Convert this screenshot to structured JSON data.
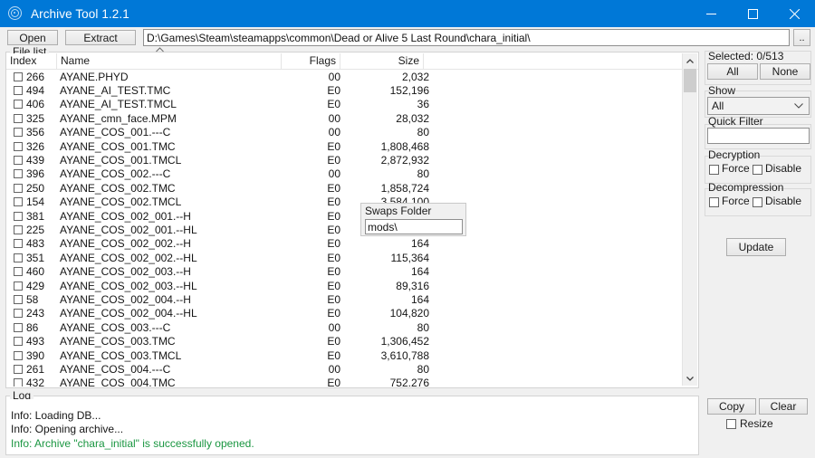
{
  "window": {
    "title": "Archive Tool 1.2.1",
    "icon": "archive-spiral-icon",
    "accent_color": "#0078d7",
    "minimize_label": "Minimize",
    "maximize_label": "Maximize",
    "close_label": "Close"
  },
  "toolbar": {
    "open_label": "Open",
    "extract_label": "Extract",
    "path_value": "D:\\Games\\Steam\\steamapps\\common\\Dead or Alive 5 Last Round\\chara_initial\\",
    "browse_label": ".."
  },
  "file_list": {
    "group_label": "File list",
    "sort_column": "Name",
    "sort_direction": "ascending",
    "columns": [
      "Index",
      "Name",
      "Flags",
      "Size"
    ],
    "rows": [
      {
        "index": "266",
        "name": "AYANE.PHYD",
        "flags": "00",
        "size": "2,032",
        "checked": false
      },
      {
        "index": "494",
        "name": "AYANE_AI_TEST.TMC",
        "flags": "E0",
        "size": "152,196",
        "checked": false
      },
      {
        "index": "406",
        "name": "AYANE_AI_TEST.TMCL",
        "flags": "E0",
        "size": "36",
        "checked": false
      },
      {
        "index": "325",
        "name": "AYANE_cmn_face.MPM",
        "flags": "00",
        "size": "28,032",
        "checked": false
      },
      {
        "index": "356",
        "name": "AYANE_COS_001.---C",
        "flags": "00",
        "size": "80",
        "checked": false
      },
      {
        "index": "326",
        "name": "AYANE_COS_001.TMC",
        "flags": "E0",
        "size": "1,808,468",
        "checked": false
      },
      {
        "index": "439",
        "name": "AYANE_COS_001.TMCL",
        "flags": "E0",
        "size": "2,872,932",
        "checked": false
      },
      {
        "index": "396",
        "name": "AYANE_COS_002.---C",
        "flags": "00",
        "size": "80",
        "checked": false
      },
      {
        "index": "250",
        "name": "AYANE_COS_002.TMC",
        "flags": "E0",
        "size": "1,858,724",
        "checked": false
      },
      {
        "index": "154",
        "name": "AYANE_COS_002.TMCL",
        "flags": "E0",
        "size": "3,584,100",
        "checked": false
      },
      {
        "index": "381",
        "name": "AYANE_COS_002_001.--H",
        "flags": "E0",
        "size": "",
        "checked": false
      },
      {
        "index": "225",
        "name": "AYANE_COS_002_001.--HL",
        "flags": "E0",
        "size": "",
        "checked": false
      },
      {
        "index": "483",
        "name": "AYANE_COS_002_002.--H",
        "flags": "E0",
        "size": "164",
        "checked": false
      },
      {
        "index": "351",
        "name": "AYANE_COS_002_002.--HL",
        "flags": "E0",
        "size": "115,364",
        "checked": false
      },
      {
        "index": "460",
        "name": "AYANE_COS_002_003.--H",
        "flags": "E0",
        "size": "164",
        "checked": false
      },
      {
        "index": "429",
        "name": "AYANE_COS_002_003.--HL",
        "flags": "E0",
        "size": "89,316",
        "checked": false
      },
      {
        "index": "58",
        "name": "AYANE_COS_002_004.--H",
        "flags": "E0",
        "size": "164",
        "checked": false
      },
      {
        "index": "243",
        "name": "AYANE_COS_002_004.--HL",
        "flags": "E0",
        "size": "104,820",
        "checked": false
      },
      {
        "index": "86",
        "name": "AYANE_COS_003.---C",
        "flags": "00",
        "size": "80",
        "checked": false
      },
      {
        "index": "493",
        "name": "AYANE_COS_003.TMC",
        "flags": "E0",
        "size": "1,306,452",
        "checked": false
      },
      {
        "index": "390",
        "name": "AYANE_COS_003.TMCL",
        "flags": "E0",
        "size": "3,610,788",
        "checked": false
      },
      {
        "index": "261",
        "name": "AYANE_COS_004.---C",
        "flags": "00",
        "size": "80",
        "checked": false
      },
      {
        "index": "432",
        "name": "AYANE_COS_004.TMC",
        "flags": "E0",
        "size": "752,276",
        "checked": false
      }
    ]
  },
  "swaps_popup": {
    "title": "Swaps Folder",
    "value": "mods\\"
  },
  "right_panel": {
    "selected_label": "Selected: 0/513",
    "all_label": "All",
    "none_label": "None",
    "show_label": "Show",
    "show_value": "All",
    "show_options": [
      "All"
    ],
    "quick_filter_label": "Quick Filter",
    "quick_filter_value": "",
    "decryption_label": "Decryption",
    "decryption_force_label": "Force",
    "decryption_disable_label": "Disable",
    "decompression_label": "Decompression",
    "decompression_force_label": "Force",
    "decompression_disable_label": "Disable",
    "update_label": "Update"
  },
  "log": {
    "group_label": "Log",
    "lines": [
      {
        "text": "Info: Loading DB...",
        "color": "#151515"
      },
      {
        "text": "Info: Opening archive...",
        "color": "#151515"
      },
      {
        "text": "Info: Archive \"chara_initial\" is successfully opened.",
        "color": "#1a9641"
      }
    ],
    "copy_label": "Copy",
    "clear_label": "Clear",
    "resize_label": "Resize"
  }
}
